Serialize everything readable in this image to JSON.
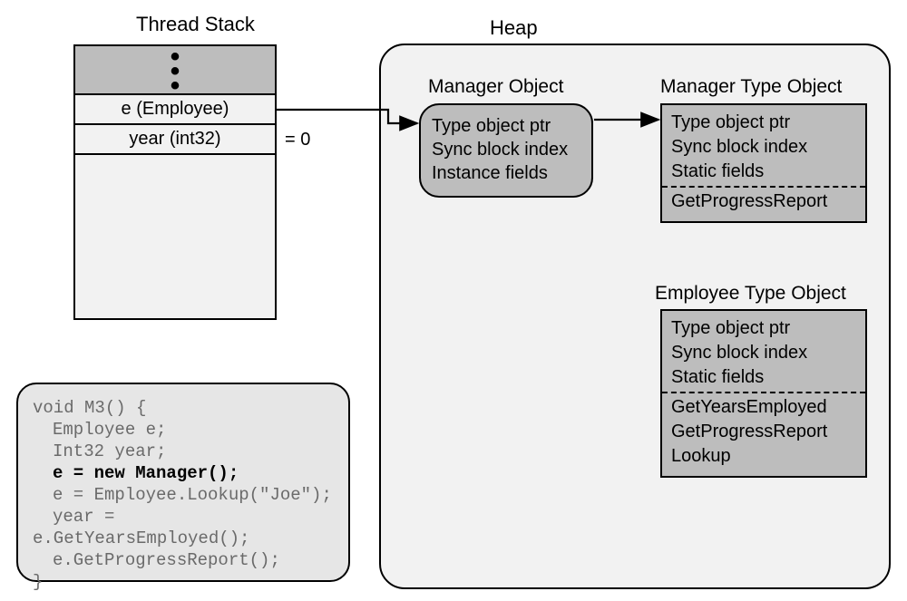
{
  "threadStack": {
    "title": "Thread Stack",
    "dotRow": "⋮",
    "row1": "e (Employee)",
    "row2": "year (int32)",
    "yearValue": "=   0"
  },
  "heap": {
    "title": "Heap",
    "managerObject": {
      "title": "Manager Object",
      "lines": {
        "l1": "Type object ptr",
        "l2": "Sync block index",
        "l3": "Instance fields"
      }
    },
    "managerTypeObject": {
      "title": "Manager Type Object",
      "top": {
        "l1": "Type object ptr",
        "l2": "Sync block index",
        "l3": "Static fields"
      },
      "methods": {
        "m1": "GetProgressReport"
      }
    },
    "employeeTypeObject": {
      "title": "Employee Type Object",
      "top": {
        "l1": "Type object ptr",
        "l2": "Sync block index",
        "l3": "Static fields"
      },
      "methods": {
        "m1": "GetYearsEmployed",
        "m2": "GetProgressReport",
        "m3": "Lookup"
      }
    }
  },
  "code": {
    "l1a": "void",
    "l1b": " M3() {",
    "l2": "Employee e;",
    "l3a": "Int32",
    "l3b": " year;",
    "l4": "e = new Manager();",
    "l5": "e = Employee.Lookup(\"Joe\");",
    "l6": "year = e.GetYearsEmployed();",
    "l7": "e.GetProgressReport();",
    "l8": "}"
  }
}
